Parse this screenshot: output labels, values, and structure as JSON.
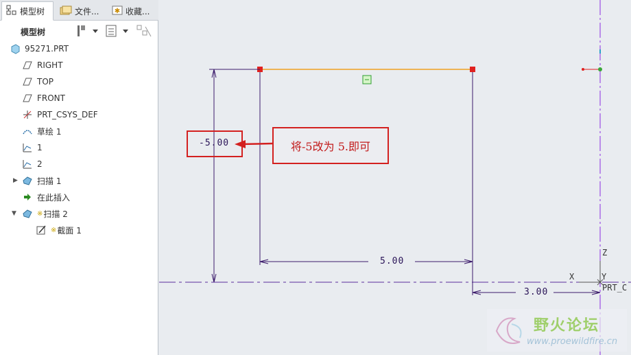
{
  "tabs": [
    {
      "label": "模型树",
      "icon": "model-tree-icon"
    },
    {
      "label": "文件...",
      "icon": "folder-icon"
    },
    {
      "label": "收藏...",
      "icon": "favorites-icon"
    }
  ],
  "tree_toolbar": {
    "title": "模型树"
  },
  "tree": {
    "root": "95271.PRT",
    "items": [
      {
        "label": "RIGHT",
        "icon": "datum-plane-icon"
      },
      {
        "label": "TOP",
        "icon": "datum-plane-icon"
      },
      {
        "label": "FRONT",
        "icon": "datum-plane-icon"
      },
      {
        "label": "PRT_CSYS_DEF",
        "icon": "csys-icon"
      },
      {
        "label": "草绘 1",
        "icon": "sketch-icon"
      },
      {
        "label": "1",
        "icon": "datum-curve-icon"
      },
      {
        "label": "2",
        "icon": "datum-curve-icon"
      },
      {
        "label": "扫描 1",
        "icon": "sweep-icon"
      },
      {
        "label": "在此插入",
        "icon": "insert-arrow-icon"
      },
      {
        "label": "扫描 2",
        "icon": "sweep-icon",
        "prefix": "※"
      },
      {
        "label": "截面 1",
        "icon": "section-icon",
        "prefix": "※"
      }
    ]
  },
  "canvas": {
    "dim_vertical": "-5.00",
    "dim_horizontal": "5.00",
    "dim_offset": "3.00",
    "axis_z": "Z",
    "axis_x": "X",
    "axis_y": "Y",
    "csys_label": "PRT_C",
    "callout": "将-5改为 5.即可"
  },
  "watermark": {
    "title": "野火论坛",
    "url": "www.proewildfire.cn"
  },
  "colors": {
    "accent": "#d3201f",
    "sketch_line": "#3b1a6b",
    "highlight_line": "#f0a020",
    "centerline": "#8a2be2"
  }
}
